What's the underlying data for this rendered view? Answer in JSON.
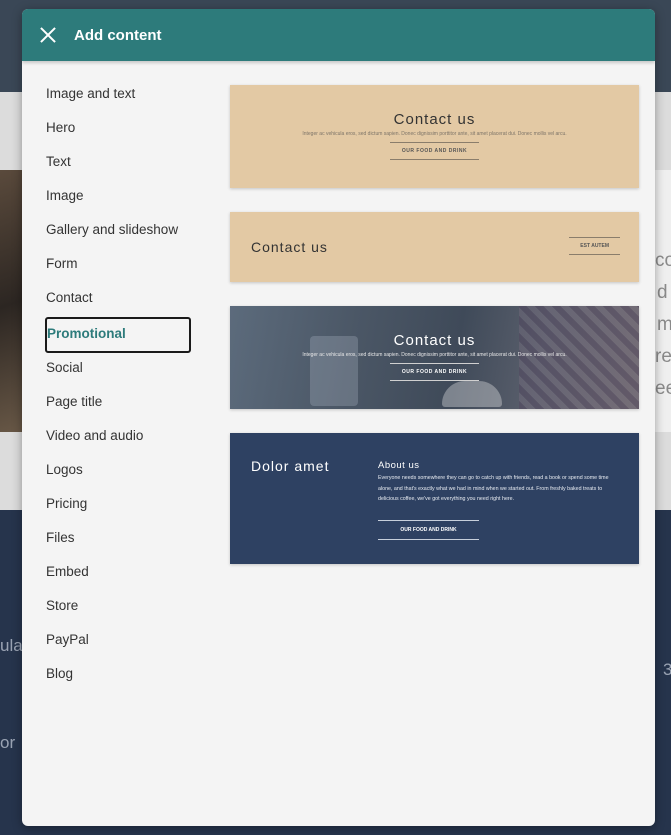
{
  "dialog": {
    "title": "Add content",
    "close_icon": "close-icon"
  },
  "sidebar": {
    "items": [
      {
        "label": "Image and text"
      },
      {
        "label": "Hero"
      },
      {
        "label": "Text"
      },
      {
        "label": "Image"
      },
      {
        "label": "Gallery and slideshow"
      },
      {
        "label": "Form"
      },
      {
        "label": "Contact"
      },
      {
        "label": "Promotional"
      },
      {
        "label": "Social"
      },
      {
        "label": "Page title"
      },
      {
        "label": "Video and audio"
      },
      {
        "label": "Logos"
      },
      {
        "label": "Pricing"
      },
      {
        "label": "Files"
      },
      {
        "label": "Embed"
      },
      {
        "label": "Store"
      },
      {
        "label": "PayPal"
      },
      {
        "label": "Blog"
      }
    ],
    "selected": "Promotional"
  },
  "templates": [
    {
      "title": "Contact us",
      "subtitle": "Integer ac vehicula eros, sed dictum sapien. Donec dignissim porttitor ante, sit amet placerat dui. Donec mollis vel arcu.",
      "button": "OUR FOOD AND DRINK"
    },
    {
      "title": "Contact us",
      "button": "EST AUTEM"
    },
    {
      "title": "Contact us",
      "subtitle": "Integer ac vehicula eros, sed dictum sapien. Donec dignissim porttitor ante, sit amet placerat dui. Donec mollis vel arcu.",
      "button": "OUR FOOD AND DRINK"
    },
    {
      "title": "Dolor amet",
      "heading": "About us",
      "body": "Everyone needs somewhere they can go to catch up with friends, read a book or spend some time alone, and that's exactly what we had in mind when we started out. From freshly baked treats to delicious coffee, we've got everything you need right here.",
      "button": "OUR FOOD AND DRINK"
    }
  ],
  "background": {
    "fragments": [
      "co",
      "d",
      "m",
      "re",
      "ee",
      "ula",
      "or",
      "3"
    ]
  },
  "colors": {
    "header": "#2d7b7b",
    "accent_text": "#2d7b7b",
    "tan_card": "#e3c9a4",
    "navy_card": "#2e4162"
  }
}
